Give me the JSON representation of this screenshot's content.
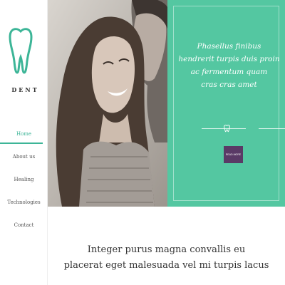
{
  "brand": {
    "name": "DENT",
    "logo_icon": "tooth-icon"
  },
  "colors": {
    "accent": "#3cb597",
    "teal_panel": "#54c7a1",
    "button": "#5a3a66"
  },
  "nav": {
    "items": [
      {
        "label": "Home",
        "active": true
      },
      {
        "label": "About us",
        "active": false
      },
      {
        "label": "Healing",
        "active": false
      },
      {
        "label": "Technologies",
        "active": false
      },
      {
        "label": "Contact",
        "active": false
      }
    ]
  },
  "hero": {
    "quote_lines": [
      "Phasellus finibus",
      "hendrerit turpis duis proin",
      "ac fermentum quam",
      "cras cras amet"
    ],
    "divider_icon": "tooth-icon",
    "button_label": "READ MORE"
  },
  "lower": {
    "lines": [
      "Integer purus magna convallis eu",
      "placerat eget malesuada vel mi turpis lacus"
    ]
  }
}
